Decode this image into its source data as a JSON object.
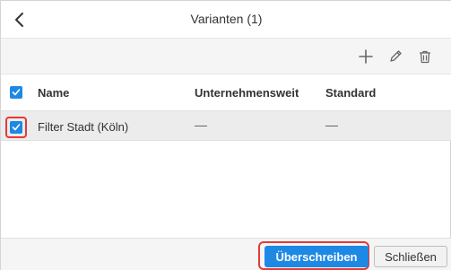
{
  "dialog": {
    "title": "Varianten (1)"
  },
  "toolbar": {
    "icons": [
      "plus-icon",
      "pencil-icon",
      "trash-icon"
    ]
  },
  "table": {
    "columns": [
      "Name",
      "Unternehmensweit",
      "Standard"
    ],
    "rows": [
      {
        "name": "Filter Stadt (Köln)",
        "unternehmensweit": "",
        "standard": "",
        "checked": true
      }
    ],
    "header_checked": true
  },
  "footer": {
    "primary_label": "Überschreiben",
    "secondary_label": "Schließen"
  },
  "colors": {
    "accent": "#1e88e5",
    "highlight": "#e53935",
    "row_bg": "#ececec"
  }
}
